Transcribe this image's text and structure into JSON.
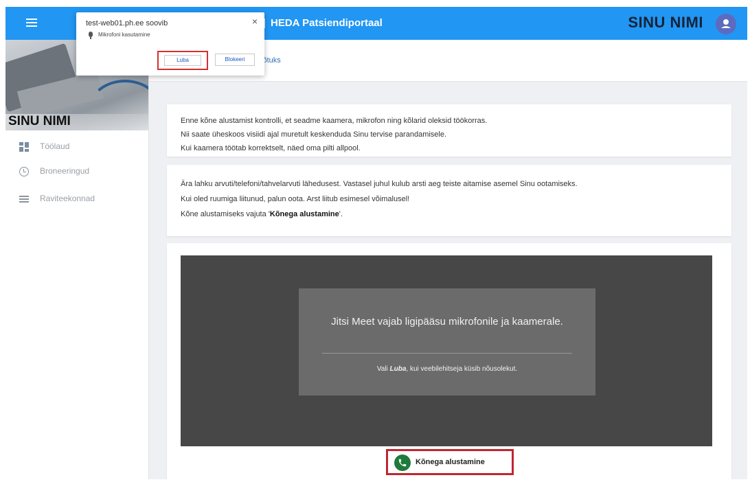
{
  "header": {
    "app_title": "HEDA Patsiendiportaal",
    "user_name": "SINU NIMI"
  },
  "sidebar": {
    "user_name": "SINU NIMI",
    "items": [
      {
        "label": "Töölaud",
        "icon": "dashboard-icon"
      },
      {
        "label": "Broneeringud",
        "icon": "clock-icon"
      },
      {
        "label": "Raviteekonnad",
        "icon": "list-icon"
      }
    ]
  },
  "tab": {
    "label": "võtuks"
  },
  "info_card_1": {
    "lines": [
      "Enne kõne alustamist kontrolli, et seadme kaamera, mikrofon ning kõlarid oleksid töökorras.",
      "Nii saate üheskoos visiidi ajal muretult keskenduda Sinu tervise parandamisele.",
      "Kui kaamera töötab korrektselt, näed oma pilti allpool."
    ]
  },
  "info_card_2": {
    "lines": [
      "Ära lahku arvuti/telefoni/tahvelarvuti lähedusest. Vastasel juhul kulub arsti aeg teiste aitamise asemel Sinu ootamiseks.",
      "Kui oled ruumiga liitunud, palun oota. Arst liitub esimesel võimalusel!"
    ],
    "line3_prefix": "Kõne alustamiseks vajuta '",
    "line3_bold": "Kõnega alustamine",
    "line3_suffix": "'."
  },
  "video": {
    "dialog_title": "Jitsi Meet vajab ligipääsu mikrofonile ja kaamerale.",
    "hint_prefix": "Vali ",
    "hint_emphasis": "Luba",
    "hint_suffix": ", kui veebilehitseja küsib nõusolekut."
  },
  "start_call": {
    "label": "Kõnega alustamine"
  },
  "permission_popup": {
    "origin": "test-web01.ph.ee soovib",
    "request": "Mikrofoni kasutamine",
    "close": "×",
    "allow_label": "Luba",
    "block_label": "Blokeeri"
  },
  "colors": {
    "primary": "#2196f3",
    "call_green": "#1f7a3c",
    "highlight_red": "#c0262e"
  }
}
